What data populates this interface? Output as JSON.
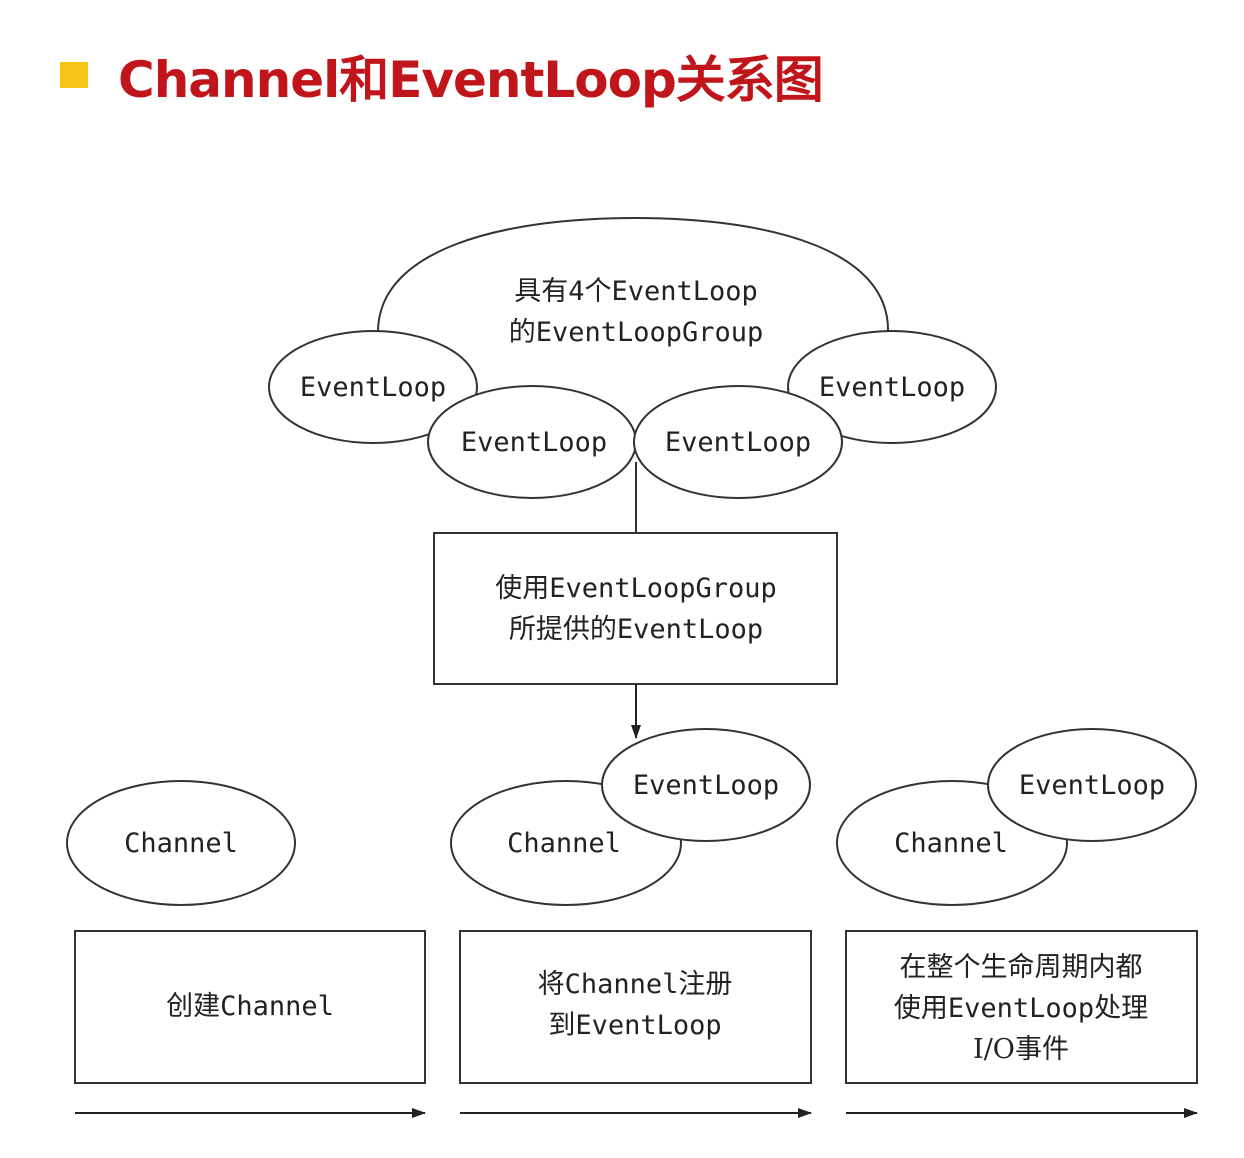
{
  "title": "Channel和EventLoop关系图",
  "group": {
    "label_line1": "具有4个EventLoop",
    "label_line2": "的EventLoopGroup",
    "loops": [
      "EventLoop",
      "EventLoop",
      "EventLoop",
      "EventLoop"
    ]
  },
  "provide_box": {
    "line1": "使用EventLoopGroup",
    "line2": "所提供的EventLoop"
  },
  "stages": [
    {
      "channel": "Channel",
      "box_lines": [
        "创建Channel"
      ]
    },
    {
      "channel": "Channel",
      "loop": "EventLoop",
      "box_lines": [
        "将Channel注册",
        "到EventLoop"
      ]
    },
    {
      "channel": "Channel",
      "loop": "EventLoop",
      "box_lines": [
        "在整个生命周期内都",
        "使用EventLoop处理",
        "I/O事件"
      ]
    }
  ]
}
